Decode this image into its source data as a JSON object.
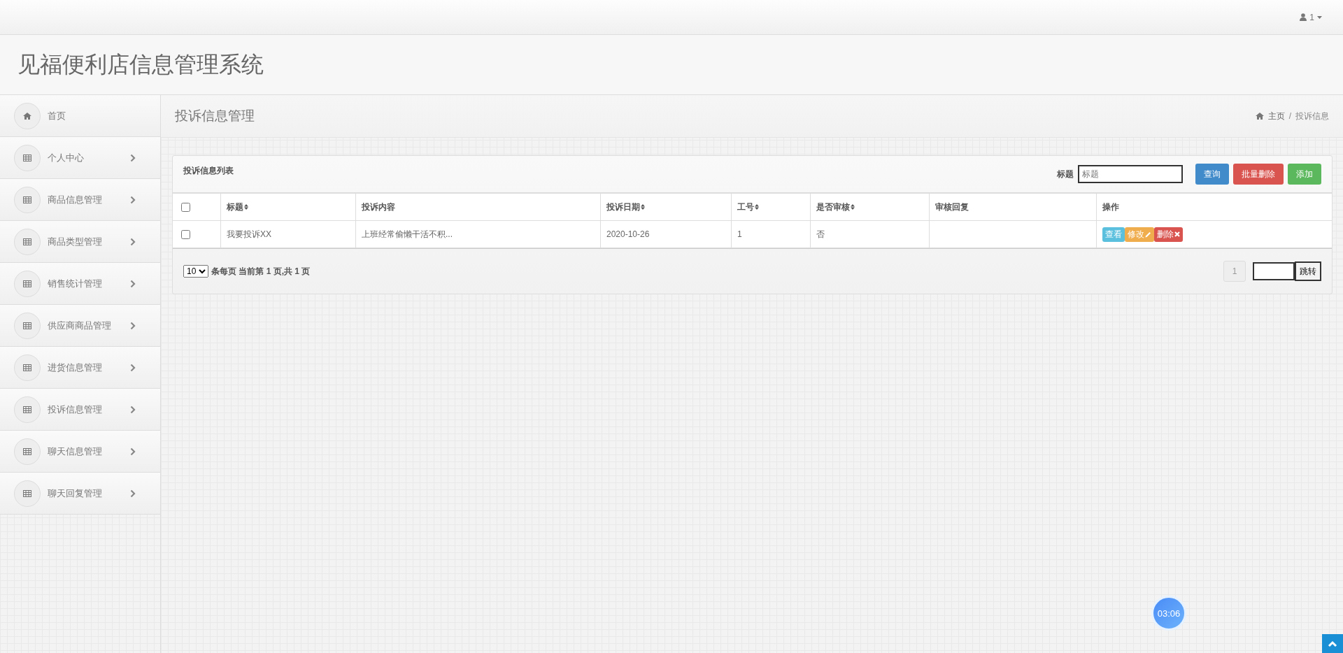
{
  "navbar": {
    "user": "1"
  },
  "app_title": "见福便利店信息管理系统",
  "sidebar": {
    "items": [
      {
        "label": "首页",
        "kind": "home"
      },
      {
        "label": "个人中心",
        "kind": "menu"
      },
      {
        "label": "商品信息管理",
        "kind": "menu"
      },
      {
        "label": "商品类型管理",
        "kind": "menu"
      },
      {
        "label": "销售统计管理",
        "kind": "menu"
      },
      {
        "label": "供应商商品管理",
        "kind": "menu"
      },
      {
        "label": "进货信息管理",
        "kind": "menu"
      },
      {
        "label": "投诉信息管理",
        "kind": "menu"
      },
      {
        "label": "聊天信息管理",
        "kind": "menu"
      },
      {
        "label": "聊天回复管理",
        "kind": "menu"
      }
    ]
  },
  "page_header": {
    "title": "投诉信息管理",
    "breadcrumb": [
      "主页",
      "投诉信息"
    ],
    "separator": "/"
  },
  "panel": {
    "title": "投诉信息列表",
    "search": {
      "label": "标题",
      "placeholder": "标题"
    },
    "buttons": [
      {
        "label": "查询",
        "kind": "primary"
      },
      {
        "label": "批量删除",
        "kind": "danger"
      },
      {
        "label": "添加",
        "kind": "success"
      }
    ],
    "table": {
      "columns": [
        {
          "label": "标题",
          "sortable": true
        },
        {
          "label": "投诉内容",
          "sortable": false
        },
        {
          "label": "投诉日期",
          "sortable": true
        },
        {
          "label": "工号",
          "sortable": true
        },
        {
          "label": "是否审核",
          "sortable": true
        },
        {
          "label": "审核回复",
          "sortable": false
        },
        {
          "label": "操作",
          "sortable": false
        }
      ],
      "header_checked": false,
      "rows": [
        {
          "checked": false,
          "cells": [
            "我要投诉XX",
            "上班经常偷懒干活不积...",
            "2020-10-26",
            "1",
            "否",
            ""
          ],
          "actions": [
            {
              "label": "查看",
              "kind": "info"
            },
            {
              "label": "修改",
              "kind": "warning"
            },
            {
              "label": "删除",
              "kind": "danger"
            }
          ]
        }
      ]
    },
    "footer": {
      "page_size": "10",
      "info_parts": [
        "条每页 当前第 ",
        "1",
        " 页,共 ",
        "1",
        " 页"
      ],
      "pages": [
        {
          "label": "1",
          "selected": true
        }
      ],
      "jump_button": "跳转"
    }
  },
  "timer": "03:06"
}
